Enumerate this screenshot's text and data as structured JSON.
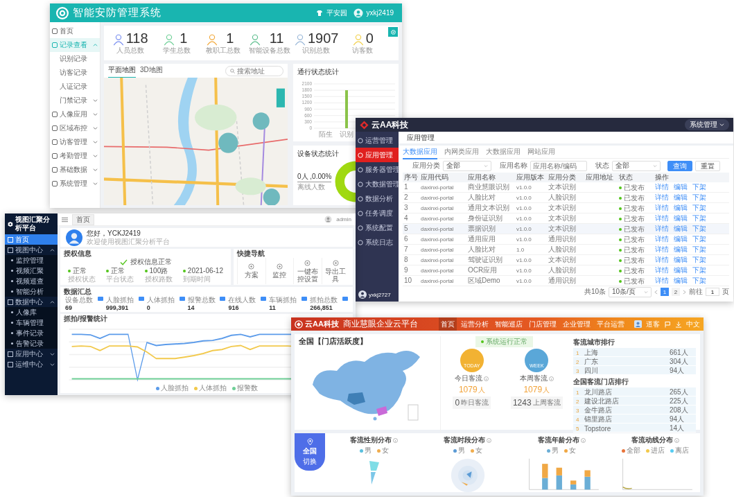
{
  "security_app": {
    "title": "智能安防管理系统",
    "site": "平安园",
    "user": "yxkj2419",
    "sidebar": [
      {
        "label": "首页",
        "selected": false
      },
      {
        "label": "记录查看",
        "selected": true,
        "expanded": true,
        "children": [
          {
            "label": "识别记录",
            "selected": false
          },
          {
            "label": "访客记录",
            "selected": false
          },
          {
            "label": "人证记录",
            "selected": false
          },
          {
            "label": "门禁记录",
            "selected": false,
            "expanded": false
          }
        ]
      },
      {
        "label": "人像应用",
        "selected": false,
        "expanded": false
      },
      {
        "label": "区域布控",
        "selected": false,
        "expanded": false
      },
      {
        "label": "访客管理",
        "selected": false,
        "expanded": false
      },
      {
        "label": "考勤管理",
        "selected": false,
        "expanded": false
      },
      {
        "label": "基础数据",
        "selected": false,
        "expanded": false
      },
      {
        "label": "系统管理",
        "selected": false,
        "expanded": false
      }
    ],
    "stats": [
      {
        "value": "118",
        "label": "人员总数"
      },
      {
        "value": "1",
        "label": "学生总数"
      },
      {
        "value": "1",
        "label": "教职工总数"
      },
      {
        "value": "11",
        "label": "智能设备总数"
      },
      {
        "value": "1907",
        "label": "识别总数"
      },
      {
        "value": "0",
        "label": "访客数"
      }
    ],
    "map_tabs": [
      {
        "label": "平面地图",
        "selected": true
      },
      {
        "label": "3D地图",
        "selected": false
      }
    ],
    "map_search": {
      "placeholder": "搜索地址"
    },
    "traffic_chart": {
      "chart_data": {
        "type": "bar",
        "title": "通行状态统计",
        "categories": [
          "陌生",
          "识别"
        ],
        "values": [
          0,
          1800
        ],
        "ylim": [
          0,
          2100
        ],
        "yticks": [
          0,
          300,
          600,
          900,
          1200,
          1500,
          1800,
          2100
        ],
        "grid": true
      }
    },
    "device_chart": {
      "title": "设备状态统计",
      "reading": "0人 ,0.00%",
      "caption": "离线人数"
    }
  },
  "app_console": {
    "brand": "云AA科技",
    "admin_menu": "系统管理",
    "user": "yxkj2727",
    "sidebar": [
      {
        "label": "运营管理",
        "selected": false
      },
      {
        "label": "应用管理",
        "selected": true
      },
      {
        "label": "服务器管理",
        "selected": false
      },
      {
        "label": "大数据管理",
        "selected": false
      },
      {
        "label": "数据分析",
        "selected": false
      },
      {
        "label": "任务调度",
        "selected": false
      },
      {
        "label": "系统配置",
        "selected": false
      },
      {
        "label": "系统日志",
        "selected": false
      }
    ],
    "page_title": "应用管理",
    "tabs": [
      {
        "label": "大数据应用",
        "selected": true
      },
      {
        "label": "内网类应用",
        "selected": false
      },
      {
        "label": "大数据应用",
        "selected": false
      },
      {
        "label": "网站应用",
        "selected": false
      }
    ],
    "filters": [
      {
        "kind": "select",
        "label": "应用分类",
        "value": "全部"
      },
      {
        "kind": "input",
        "label": "应用名称",
        "placeholder": "应用名称/编码"
      },
      {
        "kind": "select",
        "label": "状态",
        "value": "全部"
      }
    ],
    "buttons": [
      {
        "kind": "primary",
        "label": "查询"
      },
      {
        "kind": "plain",
        "label": "重置"
      }
    ],
    "columns": [
      "序号",
      "应用代码",
      "应用名称",
      "应用版本",
      "应用分类",
      "应用地址",
      "状态",
      "操作"
    ],
    "rows": [
      {
        "no": "1",
        "code": "daxinxi-portal",
        "name": "商业慧眼识别",
        "version": "v1.0.0",
        "category": "文本识别",
        "status": "已发布",
        "actions": [
          "详情",
          "编辑",
          "下架"
        ],
        "selected": false
      },
      {
        "no": "2",
        "code": "daxinxi-portal",
        "name": "人脸比对",
        "version": "v1.0.0",
        "category": "人脸识别",
        "status": "已发布",
        "actions": [
          "详情",
          "编辑",
          "下架"
        ],
        "selected": false
      },
      {
        "no": "3",
        "code": "daxinxi-portal",
        "name": "通用文本识别",
        "version": "v1.0.0",
        "category": "文本识别",
        "status": "已发布",
        "actions": [
          "详情",
          "编辑",
          "下架"
        ],
        "selected": false
      },
      {
        "no": "4",
        "code": "daxinxi-portal",
        "name": "身份证识别",
        "version": "v1.0.0",
        "category": "文本识别",
        "status": "已发布",
        "actions": [
          "详情",
          "编辑",
          "下架"
        ],
        "selected": false
      },
      {
        "no": "5",
        "code": "daxinxi-portal",
        "name": "票据识别",
        "version": "v1.0.0",
        "category": "文本识别",
        "status": "已发布",
        "actions": [
          "详情",
          "编辑",
          "下架"
        ],
        "selected": true
      },
      {
        "no": "6",
        "code": "daxinxi-portal",
        "name": "通用应用",
        "version": "v1.0.0",
        "category": "通用识别",
        "status": "已发布",
        "actions": [
          "详情",
          "编辑",
          "下架"
        ],
        "selected": false
      },
      {
        "no": "7",
        "code": "daxinxi-portal",
        "name": "人脸比对",
        "version": "1.0",
        "category": "人脸识别",
        "status": "已发布",
        "actions": [
          "详情",
          "编辑",
          "下架"
        ],
        "selected": false
      },
      {
        "no": "8",
        "code": "daxinxi-portal",
        "name": "驾驶证识别",
        "version": "v1.0.0",
        "category": "文本识别",
        "status": "已发布",
        "actions": [
          "详情",
          "编辑",
          "下架"
        ],
        "selected": false
      },
      {
        "no": "9",
        "code": "daxinxi-portal",
        "name": "OCR应用",
        "version": "v1.0.0",
        "category": "人脸识别",
        "status": "已发布",
        "actions": [
          "详情",
          "编辑",
          "下架"
        ],
        "selected": false
      },
      {
        "no": "10",
        "code": "daxinxi-portal",
        "name": "区域Demo",
        "version": "v1.0.0",
        "category": "通用识别",
        "status": "已发布",
        "actions": [
          "详情",
          "编辑",
          "下架"
        ],
        "selected": false
      }
    ],
    "pagination": {
      "total": "共10条",
      "page_size": "10条/页",
      "pages": [
        {
          "label": "1",
          "selected": true
        },
        {
          "label": "2",
          "selected": false
        }
      ],
      "goto": "前往",
      "goto_value": "1",
      "goto_unit": "页"
    }
  },
  "analytics": {
    "title": "视图汇聚分析平台",
    "tab": "首页",
    "user": "admin",
    "sidebar": [
      {
        "label": "首页",
        "selected": true
      },
      {
        "label": "视图中心",
        "selected": false,
        "expanded": true,
        "children": [
          {
            "label": "监控管理",
            "selected": false
          },
          {
            "label": "视频汇聚",
            "selected": false
          },
          {
            "label": "视频巡查",
            "selected": false
          },
          {
            "label": "智能分析",
            "selected": false
          }
        ]
      },
      {
        "label": "数据中心",
        "selected": false,
        "expanded": true,
        "children": [
          {
            "label": "人像库",
            "selected": false
          },
          {
            "label": "车辆管理",
            "selected": false
          },
          {
            "label": "事件记录",
            "selected": false
          },
          {
            "label": "告警记录",
            "selected": false
          }
        ]
      },
      {
        "label": "应用中心",
        "selected": false,
        "expanded": false
      },
      {
        "label": "运维中心",
        "selected": false,
        "expanded": false
      }
    ],
    "greeting": "您好，YCKJ2419",
    "greeting_sub": "欢迎使用视图汇聚分析平台",
    "license": {
      "title": "授权信息",
      "status": "授权信息正常",
      "items": [
        {
          "value": "正常",
          "label": "授权状态"
        },
        {
          "value": "正常",
          "label": "平台状态"
        },
        {
          "value": "100路",
          "label": "授权路数"
        },
        {
          "value": "2021-06-12",
          "label": "到期时间"
        }
      ]
    },
    "quick_nav": {
      "title": "快捷导航",
      "items": [
        "方案",
        "监控",
        "一键布控设置",
        "导出工具"
      ]
    },
    "summary": {
      "title": "数据汇总",
      "items": [
        {
          "label": "设备总数",
          "value": "69"
        },
        {
          "label": "人脸抓拍",
          "value": "999,391"
        },
        {
          "label": "人体抓拍",
          "value": "0"
        },
        {
          "label": "报警总数",
          "value": "14"
        },
        {
          "label": "在线人数",
          "value": "916"
        },
        {
          "label": "车辆抓拍",
          "value": "11"
        },
        {
          "label": "抓拍总数",
          "value": "266,851"
        }
      ]
    },
    "chart": {
      "title": "抓拍/报警统计",
      "legend": [
        {
          "label": "人脸抓拍",
          "color": "#5b9bea"
        },
        {
          "label": "人体抓拍",
          "color": "#f2c94c"
        },
        {
          "label": "报警数",
          "color": "#6fcf97"
        }
      ]
    }
  },
  "retail": {
    "brand": "云AA科技",
    "title": "商业慧眼企业云平台",
    "user": "道客",
    "language": "中文",
    "nav": [
      {
        "label": "首页",
        "selected": true
      },
      {
        "label": "运营分析",
        "selected": false
      },
      {
        "label": "智能巡店",
        "selected": false
      },
      {
        "label": "门店管理",
        "selected": false
      },
      {
        "label": "企业管理",
        "selected": false
      },
      {
        "label": "平台运营",
        "selected": false
      }
    ],
    "map_title": "全国【门店活跃度】",
    "status": "系统运行正常",
    "today": {
      "badge": "TODAY",
      "title": "今日客流",
      "value": "1079",
      "unit": "人",
      "box_value": "0",
      "box_label": "昨日客流"
    },
    "week": {
      "badge": "WEEK",
      "title": "本周客流",
      "value": "1079",
      "unit": "人",
      "box_value": "1243",
      "box_label": "上周客流"
    },
    "city_rank": {
      "title": "客流城市排行",
      "rows": [
        {
          "rank": "1",
          "name": "上海",
          "value": "661人"
        },
        {
          "rank": "2",
          "name": "广东",
          "value": "304人"
        },
        {
          "rank": "3",
          "name": "四川",
          "value": "94人"
        }
      ]
    },
    "store_rank": {
      "title": "全国客流门店排行",
      "rows": [
        {
          "rank": "1",
          "name": "龙川路店",
          "value": "265人"
        },
        {
          "rank": "2",
          "name": "建设北路店",
          "value": "225人"
        },
        {
          "rank": "3",
          "name": "金牛路店",
          "value": "208人"
        },
        {
          "rank": "4",
          "name": "锦里路店",
          "value": "94人"
        },
        {
          "rank": "5",
          "name": "Topstore",
          "value": "14人"
        }
      ]
    },
    "region": {
      "label": "全国",
      "action": "切换"
    },
    "charts": [
      {
        "kind": "pie",
        "title": "客流性别分布",
        "legend": [
          {
            "label": "男",
            "color": "#5bc0de"
          },
          {
            "label": "女",
            "color": "#f0ad4e"
          }
        ]
      },
      {
        "kind": "polar",
        "title": "客流时段分布",
        "legend": [
          {
            "label": "男",
            "color": "#5b9bd5"
          },
          {
            "label": "女",
            "color": "#f0ad4e"
          }
        ]
      },
      {
        "kind": "bar",
        "title": "客流年龄分布",
        "legend": [
          {
            "label": "男",
            "color": "#6baed6"
          },
          {
            "label": "女",
            "color": "#f0a845"
          }
        ]
      },
      {
        "kind": "line",
        "title": "客流动线分布",
        "legend": [
          {
            "label": "全部",
            "color": "#e8743b"
          },
          {
            "label": "进店",
            "color": "#f2c94c"
          },
          {
            "label": "离店",
            "color": "#56ccf2"
          }
        ]
      }
    ]
  }
}
